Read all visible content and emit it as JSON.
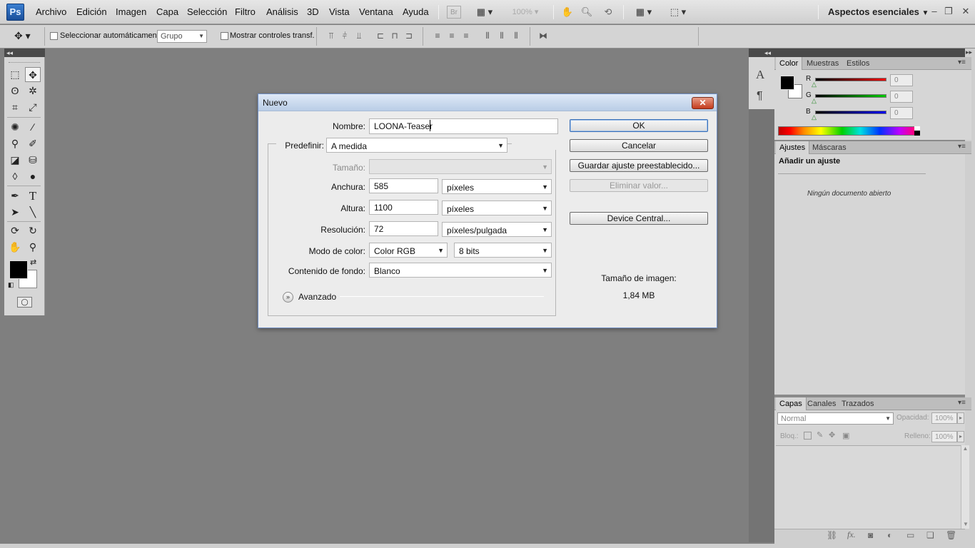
{
  "app": {
    "logo_text": "Ps",
    "workspace": "Aspectos esenciales",
    "zoom": "100%",
    "bridge": "Br"
  },
  "menu": [
    "Archivo",
    "Edición",
    "Imagen",
    "Capa",
    "Selección",
    "Filtro",
    "Análisis",
    "3D",
    "Vista",
    "Ventana",
    "Ayuda"
  ],
  "options": {
    "auto_select_label": "Seleccionar automáticamente:",
    "auto_select_value": "Grupo",
    "show_transform_label": "Mostrar controles transf."
  },
  "panels": {
    "color": {
      "tabs": [
        "Color",
        "Muestras",
        "Estilos"
      ],
      "r_label": "R",
      "g_label": "G",
      "b_label": "B",
      "r_value": "0",
      "g_value": "0",
      "b_value": "0"
    },
    "adjustments": {
      "tabs": [
        "Ajustes",
        "Máscaras"
      ],
      "heading": "Añadir un ajuste",
      "empty_text": "Ningún documento abierto"
    },
    "layers": {
      "tabs": [
        "Capas",
        "Canales",
        "Trazados"
      ],
      "blend_mode": "Normal",
      "opacity_label": "Opacidad:",
      "opacity_value": "100%",
      "lock_label": "Bloq.:",
      "fill_label": "Relleno:",
      "fill_value": "100%",
      "footer_icons": [
        "link-icon",
        "fx-icon",
        "mask-icon",
        "adjustment-icon",
        "folder-icon",
        "new-layer-icon",
        "trash-icon"
      ]
    }
  },
  "dialog": {
    "title": "Nuevo",
    "close_glyph": "✕",
    "name_label": "Nombre:",
    "name_value": "LOONA-Teaser",
    "preset_label": "Predefinir:",
    "preset_value": "A medida",
    "size_label": "Tamaño:",
    "width_label": "Anchura:",
    "width_value": "585",
    "width_unit": "píxeles",
    "height_label": "Altura:",
    "height_value": "1100",
    "height_unit": "píxeles",
    "resolution_label": "Resolución:",
    "resolution_value": "72",
    "resolution_unit": "píxeles/pulgada",
    "color_mode_label": "Modo de color:",
    "color_mode_value": "Color RGB",
    "bit_depth_value": "8 bits",
    "background_label": "Contenido de fondo:",
    "background_value": "Blanco",
    "advanced_label": "Avanzado",
    "buttons": {
      "ok": "OK",
      "cancel": "Cancelar",
      "save_preset": "Guardar ajuste preestablecido...",
      "delete_preset": "Eliminar valor...",
      "device_central": "Device Central..."
    },
    "image_size_label": "Tamaño de imagen:",
    "image_size_value": "1,84 MB"
  },
  "colors": {
    "accent": "#1b4f9a",
    "workspace_bg": "#7f7f7f",
    "panel_bg": "#d6d6d6",
    "close_red": "#c43b1c"
  }
}
